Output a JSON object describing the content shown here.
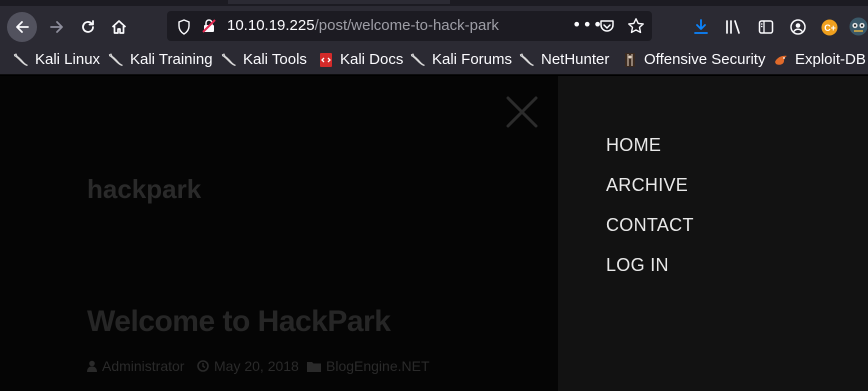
{
  "browser": {
    "url_host": "10.10.19.225",
    "url_path": "/post/welcome-to-hack-park",
    "more_label": "•••"
  },
  "bookmarks": [
    {
      "label": "Kali Linux",
      "icon": "kali-dragon-icon"
    },
    {
      "label": "Kali Training",
      "icon": "kali-dragon-icon"
    },
    {
      "label": "Kali Tools",
      "icon": "kali-dragon-icon"
    },
    {
      "label": "Kali Docs",
      "icon": "kali-docs-icon"
    },
    {
      "label": "Kali Forums",
      "icon": "kali-dragon-icon"
    },
    {
      "label": "NetHunter",
      "icon": "kali-dragon-icon"
    },
    {
      "label": "Offensive Security",
      "icon": "offsec-icon"
    },
    {
      "label": "Exploit-DB",
      "icon": "exploit-db-icon"
    }
  ],
  "site": {
    "title": "hackpark"
  },
  "post": {
    "title": "Welcome to HackPark",
    "author": "Administrator",
    "date": "May 20, 2018",
    "category": "BlogEngine.NET"
  },
  "menu": {
    "items": [
      "HOME",
      "ARCHIVE",
      "CONTACT",
      "LOG IN"
    ]
  },
  "colors": {
    "toolbar": "#2b2a33",
    "urlbar": "#1c1b22",
    "sidenav": "#121212",
    "download_accent": "#0a84ff"
  }
}
